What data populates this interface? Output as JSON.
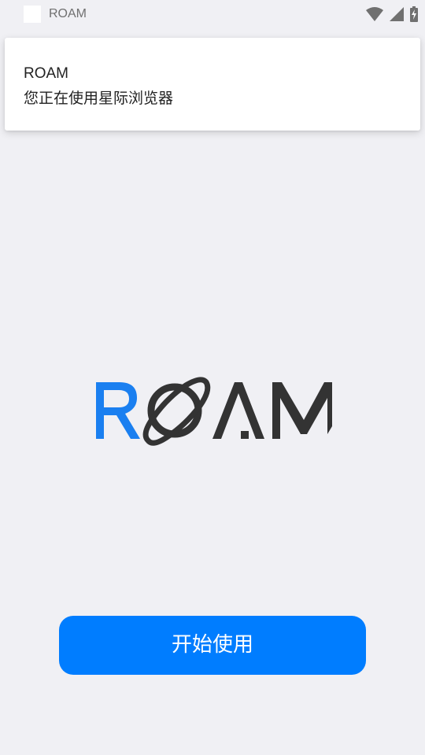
{
  "status_bar": {
    "app_name": "ROAM",
    "icons": [
      "wifi-icon",
      "cellular-signal-icon",
      "battery-charging-icon"
    ]
  },
  "notification": {
    "title": "ROAM",
    "body": "您正在使用星际浏览器"
  },
  "logo": {
    "text": "ROAM",
    "colors": {
      "r_letter": "#1a7ff0",
      "rest": "#333333"
    }
  },
  "start_button": {
    "label": "开始使用",
    "color": "#007dff"
  }
}
